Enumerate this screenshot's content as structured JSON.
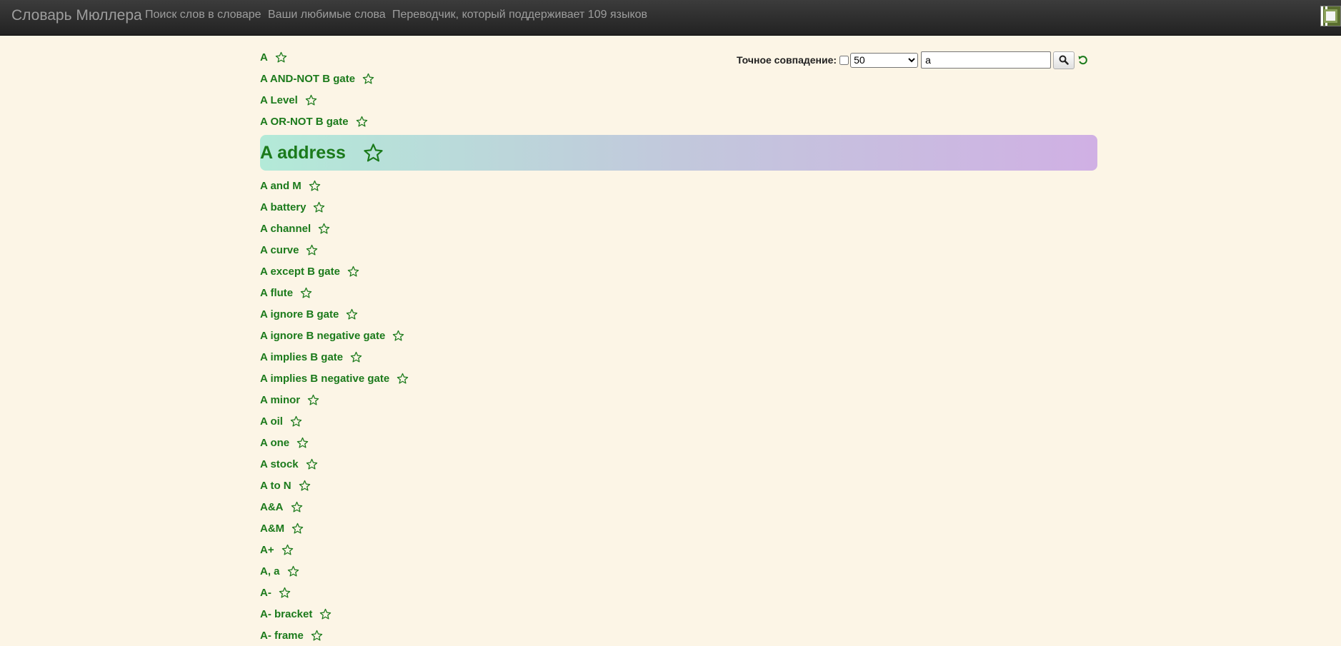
{
  "navbar": {
    "brand": "Словарь Мюллера",
    "links": [
      {
        "label": "Поиск слов в словаре"
      },
      {
        "label": "Ваши любимые слова"
      },
      {
        "label": "Переводчик, который поддерживает 109 языков"
      }
    ],
    "avatar_icon": "avatar-icon"
  },
  "search": {
    "exact_label": "Точное совпадение:",
    "exact_checked": false,
    "count_value": "50",
    "query_value": "a",
    "search_icon": "search-icon",
    "reset_icon": "refresh-icon"
  },
  "colors": {
    "background": "#fcf5e6",
    "link": "#1b7a1b",
    "navbar": "#2b2b2b",
    "highlight_start": "#b3ead8",
    "highlight_end": "#d0b0e4"
  },
  "words": [
    {
      "label": "A"
    },
    {
      "label": "A AND-NOT B gate"
    },
    {
      "label": "A Level"
    },
    {
      "label": "A OR-NOT B gate"
    },
    {
      "label": "A address",
      "highlighted": true
    },
    {
      "label": "A and M"
    },
    {
      "label": "A battery"
    },
    {
      "label": "A channel"
    },
    {
      "label": "A curve"
    },
    {
      "label": "A except B gate"
    },
    {
      "label": "A flute"
    },
    {
      "label": "A ignore B gate"
    },
    {
      "label": "A ignore B negative gate"
    },
    {
      "label": "A implies B gate"
    },
    {
      "label": "A implies B negative gate"
    },
    {
      "label": "A minor"
    },
    {
      "label": "A oil"
    },
    {
      "label": "A one"
    },
    {
      "label": "A stock"
    },
    {
      "label": "A to N"
    },
    {
      "label": "A&A"
    },
    {
      "label": "A&M"
    },
    {
      "label": "A+"
    },
    {
      "label": "A, a"
    },
    {
      "label": "A-"
    },
    {
      "label": "A- bracket"
    },
    {
      "label": "A- frame"
    }
  ]
}
